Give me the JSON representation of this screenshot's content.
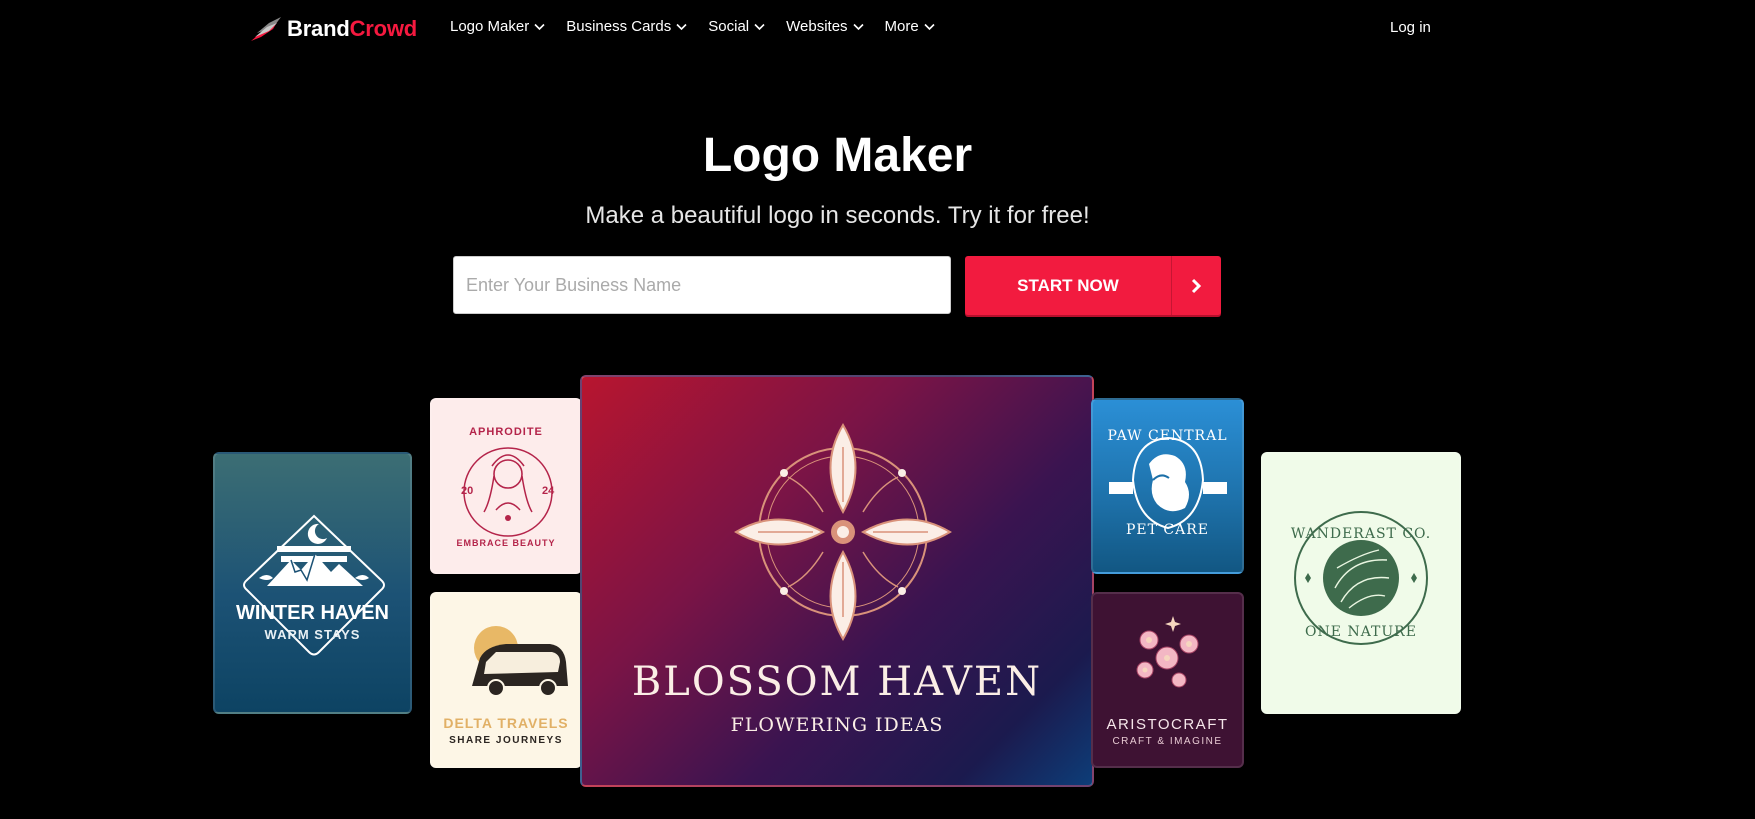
{
  "header": {
    "brand_part1": "Brand",
    "brand_part2": "Crowd",
    "nav": [
      {
        "label": "Logo Maker"
      },
      {
        "label": "Business Cards"
      },
      {
        "label": "Social"
      },
      {
        "label": "Websites"
      },
      {
        "label": "More"
      }
    ],
    "login_label": "Log in"
  },
  "hero": {
    "title": "Logo Maker",
    "subtitle": "Make a beautiful logo in seconds. Try it for free!",
    "input_placeholder": "Enter Your Business Name",
    "cta_label": "START NOW"
  },
  "cards": {
    "winter": {
      "name": "WINTER HAVEN",
      "tagline": "WARM STAYS"
    },
    "aphrodite": {
      "name": "APHRODITE",
      "year_left": "20",
      "year_right": "24",
      "tagline": "EMBRACE BEAUTY"
    },
    "delta": {
      "name": "DELTA TRAVELS",
      "tagline": "SHARE JOURNEYS"
    },
    "blossom": {
      "name": "BLOSSOM HAVEN",
      "tagline": "FLOWERING IDEAS"
    },
    "paw": {
      "name": "PAW CENTRAL",
      "tagline": "PET CARE"
    },
    "aristo": {
      "name": "ARISTOCRAFT",
      "tagline": "CRAFT & IMAGINE"
    },
    "wander": {
      "name": "WANDERAST CO.",
      "tagline": "ONE NATURE"
    }
  },
  "colors": {
    "accent": "#f21b3f",
    "background": "#000000"
  }
}
